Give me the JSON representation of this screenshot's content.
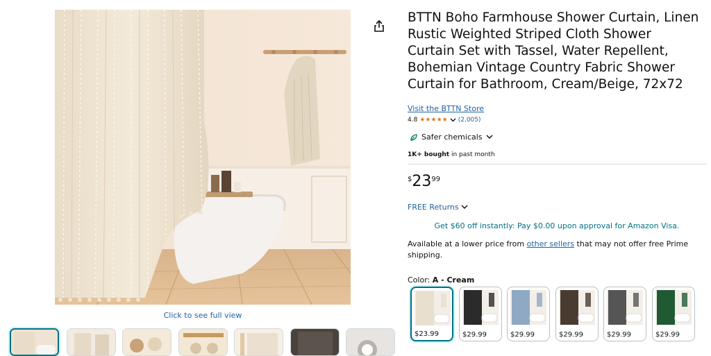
{
  "product": {
    "title": "BTTN Boho Farmhouse Shower Curtain, Linen Rustic Weighted Striped Cloth Shower Curtain Set with Tassel, Water Repellent, Bohemian Vintage Country Fabric Shower Curtain for Bathroom, Cream/Beige, 72x72",
    "store_link": "Visit the BTTN Store",
    "rating": "4.8",
    "rating_stars": 4.8,
    "rating_count": "(2,005)",
    "safer_chemicals": "Safer chemicals",
    "bought_bold": "1K+ bought",
    "bought_rest": " in past month"
  },
  "price": {
    "symbol": "$",
    "whole": "23",
    "fraction": "99"
  },
  "delivery": {
    "free_returns": "FREE Returns",
    "promo": "Get $60 off instantly: Pay $0.00 upon approval for Amazon Visa.",
    "lower_price_prefix": "Available at a lower price from ",
    "lower_price_link": "other sellers",
    "lower_price_suffix": " that may not offer free Prime shipping."
  },
  "image": {
    "click_to_see": "Click to see full view"
  },
  "color": {
    "label": "Color: ",
    "selected": "A - Cream",
    "swatches": [
      {
        "price": "$23.99",
        "color": "#e9dfce"
      },
      {
        "price": "$29.99",
        "color": "#2b2b2b"
      },
      {
        "price": "$29.99",
        "color": "#8fa8c4"
      },
      {
        "price": "$29.99",
        "color": "#4a3b30"
      },
      {
        "price": "$29.99",
        "color": "#555555"
      },
      {
        "price": "$29.99",
        "color": "#1f5a33"
      }
    ]
  },
  "colors": {
    "link": "#2162a1",
    "star": "#de7921",
    "accent": "#007185"
  }
}
